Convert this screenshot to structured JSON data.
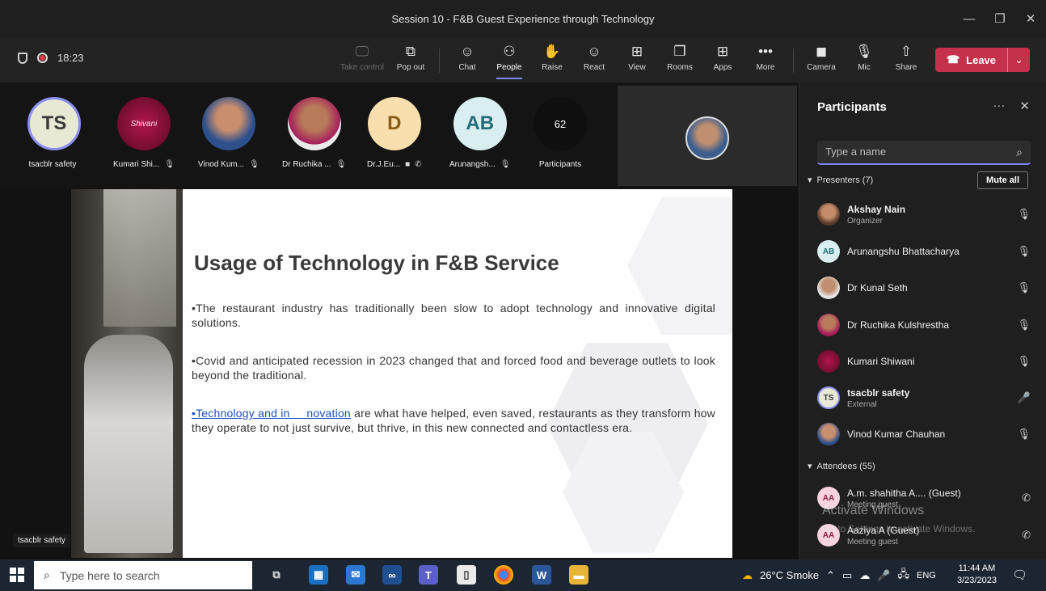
{
  "window": {
    "title": "Session 10 - F&B Guest Experience through Technology"
  },
  "toolbar": {
    "timer": "18:23",
    "buttons": [
      {
        "label": "Take control",
        "icon": "take-control-icon"
      },
      {
        "label": "Pop out",
        "icon": "pop-out-icon"
      },
      {
        "label": "Chat",
        "icon": "chat-icon"
      },
      {
        "label": "People",
        "icon": "people-icon"
      },
      {
        "label": "Raise",
        "icon": "raise-hand-icon"
      },
      {
        "label": "React",
        "icon": "react-icon"
      },
      {
        "label": "View",
        "icon": "view-icon"
      },
      {
        "label": "Rooms",
        "icon": "rooms-icon"
      },
      {
        "label": "Apps",
        "icon": "apps-icon"
      },
      {
        "label": "More",
        "icon": "more-icon"
      },
      {
        "label": "Camera",
        "icon": "camera-off-icon"
      },
      {
        "label": "Mic",
        "icon": "mic-off-icon"
      },
      {
        "label": "Share",
        "icon": "share-icon"
      }
    ],
    "leave_label": "Leave"
  },
  "strip": {
    "tiles": [
      {
        "initials": "TS",
        "name": "tsacblr safety"
      },
      {
        "initials": "Shivani",
        "name": "Kumari Shi..."
      },
      {
        "initials": "",
        "name": "Vinod Kum..."
      },
      {
        "initials": "",
        "name": "Dr Ruchika ..."
      },
      {
        "initials": "D",
        "name": "Dr.J.Eu..."
      },
      {
        "initials": "AB",
        "name": "Arunangsh..."
      },
      {
        "initials": "62",
        "name": "Participants"
      }
    ]
  },
  "slide": {
    "title": "Usage of Technology in F&B Service",
    "p1": "•The restaurant industry has traditionally been slow to adopt technology and innovative digital solutions.",
    "p2": "•Covid and anticipated recession in 2023 changed that and forced food and beverage outlets to look beyond the traditional.",
    "p3_link": "•Technology and in     novation",
    "p3_rest": " are what have helped, even saved, restaurants as they transform how they operate to not just survive, but thrive, in this new connected and contactless era."
  },
  "content_name_label": "tsacblr safety",
  "participants": {
    "header": "Participants",
    "search_placeholder": "Type a name",
    "presenters_label": "Presenters (7)",
    "mute_all": "Mute all",
    "presenters": [
      {
        "initials": "",
        "name": "Akshay Nain",
        "sub": "Organizer"
      },
      {
        "initials": "AB",
        "name": "Arunangshu Bhattacharya",
        "sub": ""
      },
      {
        "initials": "",
        "name": "Dr Kunal Seth",
        "sub": ""
      },
      {
        "initials": "",
        "name": "Dr Ruchika Kulshrestha",
        "sub": ""
      },
      {
        "initials": "",
        "name": "Kumari Shiwani",
        "sub": ""
      },
      {
        "initials": "TS",
        "name": "tsacblr safety",
        "sub": "External"
      },
      {
        "initials": "",
        "name": "Vinod Kumar Chauhan",
        "sub": ""
      }
    ],
    "attendees_label": "Attendees (55)",
    "attendees": [
      {
        "initials": "AA",
        "name": "A.m. shahitha A....  (Guest)",
        "sub": "Meeting guest"
      },
      {
        "initials": "AA",
        "name": "Aaziya A (Guest)",
        "sub": "Meeting guest"
      }
    ],
    "watermark_title": "Activate Windows",
    "watermark_sub": "Go to Settings to activate Windows."
  },
  "taskbar": {
    "search_placeholder": "Type here to search",
    "weather": "26°C  Smoke",
    "lang": "ENG",
    "time": "11:44 AM",
    "date": "3/23/2023"
  },
  "colors": {
    "accent": "#7f85f5",
    "leave": "#c4314b",
    "link": "#1a4fc4"
  }
}
